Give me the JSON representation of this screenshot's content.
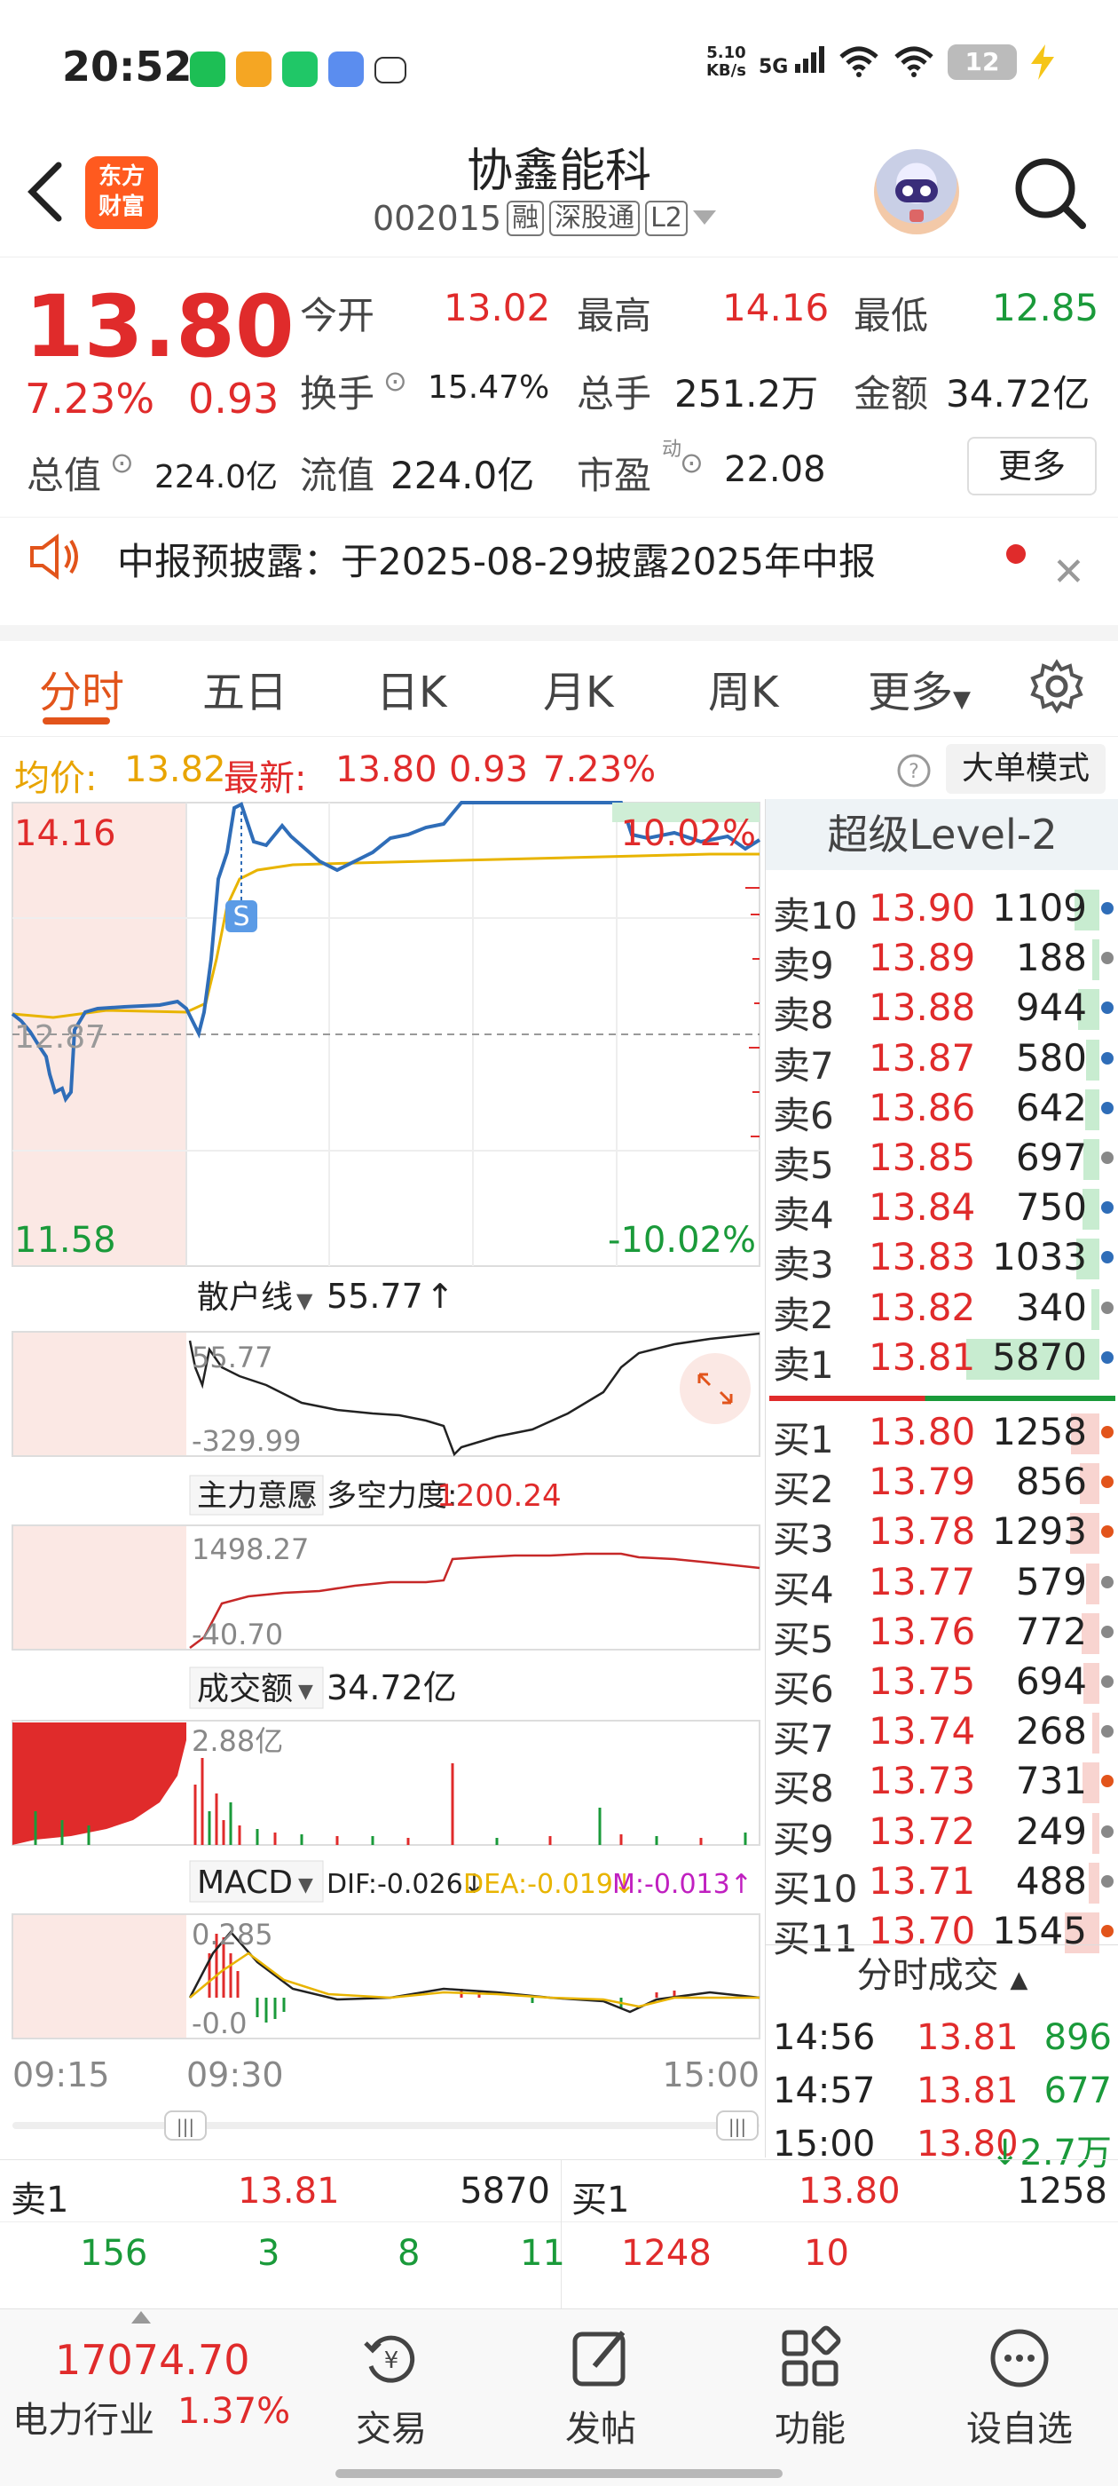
{
  "status_bar": {
    "time": "20:52",
    "net_speed": "5.10\nKB/s",
    "network": "5G",
    "battery": "12",
    "app_icons": [
      "wechat-icon",
      "notes-icon",
      "phone-icon",
      "cloud-icon",
      "misc-icon"
    ]
  },
  "header": {
    "stock_name": "协鑫能科",
    "stock_code": "002015",
    "tag_rong": "融",
    "tag_shengutong": "深股通",
    "tag_level": "L2",
    "logo_line1": "东方",
    "logo_line2": "财富"
  },
  "quote": {
    "last_price": "13.80",
    "change_pct": "7.23%",
    "change_val": "0.93",
    "open_label": "今开",
    "open": "13.02",
    "high_label": "最高",
    "high": "14.16",
    "low_label": "最低",
    "low": "12.85",
    "turnover_label": "换手",
    "turnover": "15.47%",
    "volume_label": "总手",
    "volume": "251.2万",
    "amount_label": "金额",
    "amount": "34.72亿",
    "total_cap_label": "总值",
    "total_cap": "224.0亿",
    "float_cap_label": "流值",
    "float_cap": "224.0亿",
    "pe_label": "市盈",
    "pe_sup": "动",
    "pe": "22.08",
    "more_button": "更多"
  },
  "notice": {
    "text": "中报预披露：于2025-08-29披露2025年中报"
  },
  "tabs": [
    "分时",
    "五日",
    "日K",
    "月K",
    "周K",
    "更多"
  ],
  "avg_bar": {
    "avg_label": "均价:",
    "avg_value": "13.82",
    "latest_label": "最新:",
    "latest_value": "13.80",
    "latest_change": "0.93",
    "latest_pct": "7.23%",
    "dadan_button": "大单模式"
  },
  "chart": {
    "price_top": "14.16",
    "price_bottom": "11.58",
    "pct_top": "10.02%",
    "pct_bottom": "-10.02%",
    "mid_price": "12.87",
    "marker_s": "S",
    "retail_label": "散户线",
    "retail_value": "55.77",
    "retail_arrow": "↑",
    "retail_top": "55.77",
    "retail_bottom": "-329.99",
    "main_label": "主力意愿",
    "bull_bear_label": "多空力度:",
    "bull_bear_value": "1200.24",
    "main_top": "1498.27",
    "main_bottom": "-40.70",
    "amount_label": "成交额",
    "amount_value": "34.72亿",
    "amount_top": "2.88亿",
    "macd_label": "MACD",
    "dif": "DIF:-0.026↓",
    "dea": "DEA:-0.019↓",
    "m": "M:-0.013↑",
    "macd_top": "0.285",
    "macd_bottom": "-0.0",
    "time_start": "09:15",
    "time_open": "09:30",
    "time_end": "15:00",
    "colors": {
      "up": "#e02b2b",
      "down": "#1a9a3a",
      "price_line": "#2f6db8",
      "avg_line": "#e8b400"
    }
  },
  "orderbook": {
    "title": "超级Level-2",
    "asks": [
      {
        "label": "卖10",
        "price": "13.90",
        "vol": "1109",
        "dot": "#2f6db8"
      },
      {
        "label": "卖9",
        "price": "13.89",
        "vol": "188",
        "dot": "#888888"
      },
      {
        "label": "卖8",
        "price": "13.88",
        "vol": "944",
        "dot": "#2f6db8"
      },
      {
        "label": "卖7",
        "price": "13.87",
        "vol": "580",
        "dot": "#2f6db8"
      },
      {
        "label": "卖6",
        "price": "13.86",
        "vol": "642",
        "dot": "#2f6db8"
      },
      {
        "label": "卖5",
        "price": "13.85",
        "vol": "697",
        "dot": "#888888"
      },
      {
        "label": "卖4",
        "price": "13.84",
        "vol": "750",
        "dot": "#2f6db8"
      },
      {
        "label": "卖3",
        "price": "13.83",
        "vol": "1033",
        "dot": "#2f6db8"
      },
      {
        "label": "卖2",
        "price": "13.82",
        "vol": "340",
        "dot": "#888888"
      },
      {
        "label": "卖1",
        "price": "13.81",
        "vol": "5870",
        "dot": "#2f6db8"
      }
    ],
    "bids": [
      {
        "label": "买1",
        "price": "13.80",
        "vol": "1258",
        "dot": "#e2541b"
      },
      {
        "label": "买2",
        "price": "13.79",
        "vol": "856",
        "dot": "#e2541b"
      },
      {
        "label": "买3",
        "price": "13.78",
        "vol": "1293",
        "dot": "#e2541b"
      },
      {
        "label": "买4",
        "price": "13.77",
        "vol": "579",
        "dot": "#888888"
      },
      {
        "label": "买5",
        "price": "13.76",
        "vol": "772",
        "dot": "#888888"
      },
      {
        "label": "买6",
        "price": "13.75",
        "vol": "694",
        "dot": "#888888"
      },
      {
        "label": "买7",
        "price": "13.74",
        "vol": "268",
        "dot": "#888888"
      },
      {
        "label": "买8",
        "price": "13.73",
        "vol": "731",
        "dot": "#e2541b"
      },
      {
        "label": "买9",
        "price": "13.72",
        "vol": "249",
        "dot": "#888888"
      },
      {
        "label": "买10",
        "price": "13.71",
        "vol": "488",
        "dot": "#888888"
      },
      {
        "label": "买11",
        "price": "13.70",
        "vol": "1545",
        "dot": "#e2541b"
      }
    ],
    "fenshi_title": "分时成交",
    "ticks": [
      {
        "time": "14:56",
        "price": "13.81",
        "vol": "896"
      },
      {
        "time": "14:57",
        "price": "13.81",
        "vol": "677"
      },
      {
        "time": "15:00",
        "price": "13.80",
        "vol": "↓2.7万"
      }
    ]
  },
  "bottom_table": {
    "sell_label": "卖1",
    "sell_price": "13.81",
    "sell_vol": "5870",
    "buy_label": "买1",
    "buy_price": "13.80",
    "buy_vol": "1258",
    "sell_queue": [
      "156",
      "3",
      "8",
      "11"
    ],
    "buy_queue": [
      "1248",
      "10"
    ]
  },
  "bottom_nav": {
    "index_value": "17074.70",
    "index_name": "电力行业",
    "index_pct": "1.37%",
    "items": [
      {
        "label": "交易",
        "icon": "trade-icon"
      },
      {
        "label": "发帖",
        "icon": "post-icon"
      },
      {
        "label": "功能",
        "icon": "function-icon"
      },
      {
        "label": "设自选",
        "icon": "add-watchlist-icon"
      }
    ]
  }
}
